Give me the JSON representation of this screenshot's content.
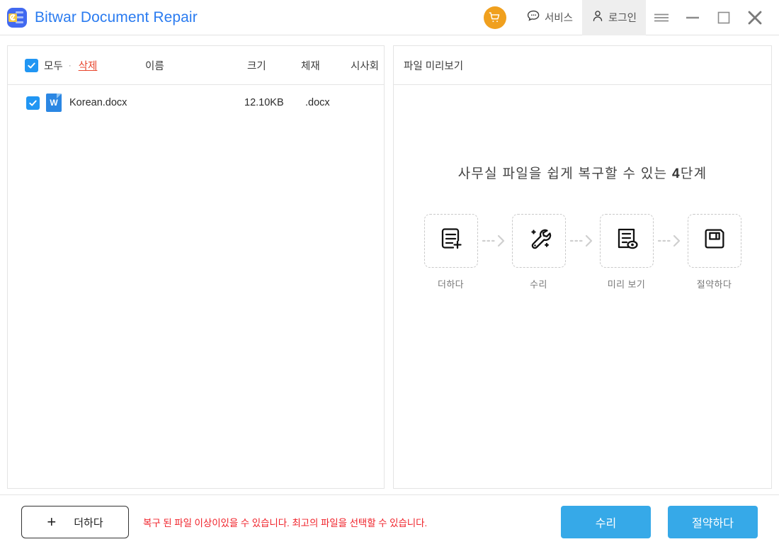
{
  "titlebar": {
    "app_title": "Bitwar Document Repair",
    "logo_icon": "app-logo-document-wrench",
    "cart_icon": "shopping-cart-icon",
    "service": {
      "label": "서비스",
      "icon": "speech-bubble-icon"
    },
    "login": {
      "label": "로그인",
      "icon": "user-person-icon"
    },
    "menu_icon": "hamburger-menu-icon",
    "minimize_icon": "minimize-icon",
    "maximize_icon": "maximize-icon",
    "close_icon": "close-x-icon"
  },
  "file_list": {
    "select_all_label": "모두",
    "separator": "·",
    "delete_label": "삭제",
    "columns": {
      "name": "이름",
      "size": "크기",
      "format": "체재",
      "preview": "시사회"
    },
    "rows": [
      {
        "checked": true,
        "icon": "word-docx-icon",
        "icon_letter": "W",
        "name": "Korean.docx",
        "size": "12.10KB",
        "format": ".docx"
      }
    ]
  },
  "preview": {
    "header_label": "파일 미리보기",
    "steps_title_prefix": "사무실 파일을 쉽게 복구할 수 있는 ",
    "steps_title_number": "4",
    "steps_title_suffix": "단계",
    "steps": [
      {
        "label": "더하다",
        "icon": "document-add-icon"
      },
      {
        "label": "수리",
        "icon": "wrench-repair-icon"
      },
      {
        "label": "미리 보기",
        "icon": "document-eye-preview-icon"
      },
      {
        "label": "절약하다",
        "icon": "floppy-disk-save-icon"
      }
    ],
    "arrow_icon": "dotted-chevron-right-icon"
  },
  "footer": {
    "add_button": {
      "label": "더하다",
      "plus": "+"
    },
    "hint": "복구 된 파일 이상이있을 수 있습니다. 최고의 파일을 선택할 수 있습니다.",
    "repair_button": "수리",
    "save_button": "절약하다"
  },
  "colors": {
    "brand_blue": "#2a7bf0",
    "accent_blue": "#36a9e8",
    "checkbox_blue": "#2196f3",
    "cart_orange": "#f0a01e",
    "delete_red": "#e8452c",
    "hint_red": "#f0222a"
  }
}
